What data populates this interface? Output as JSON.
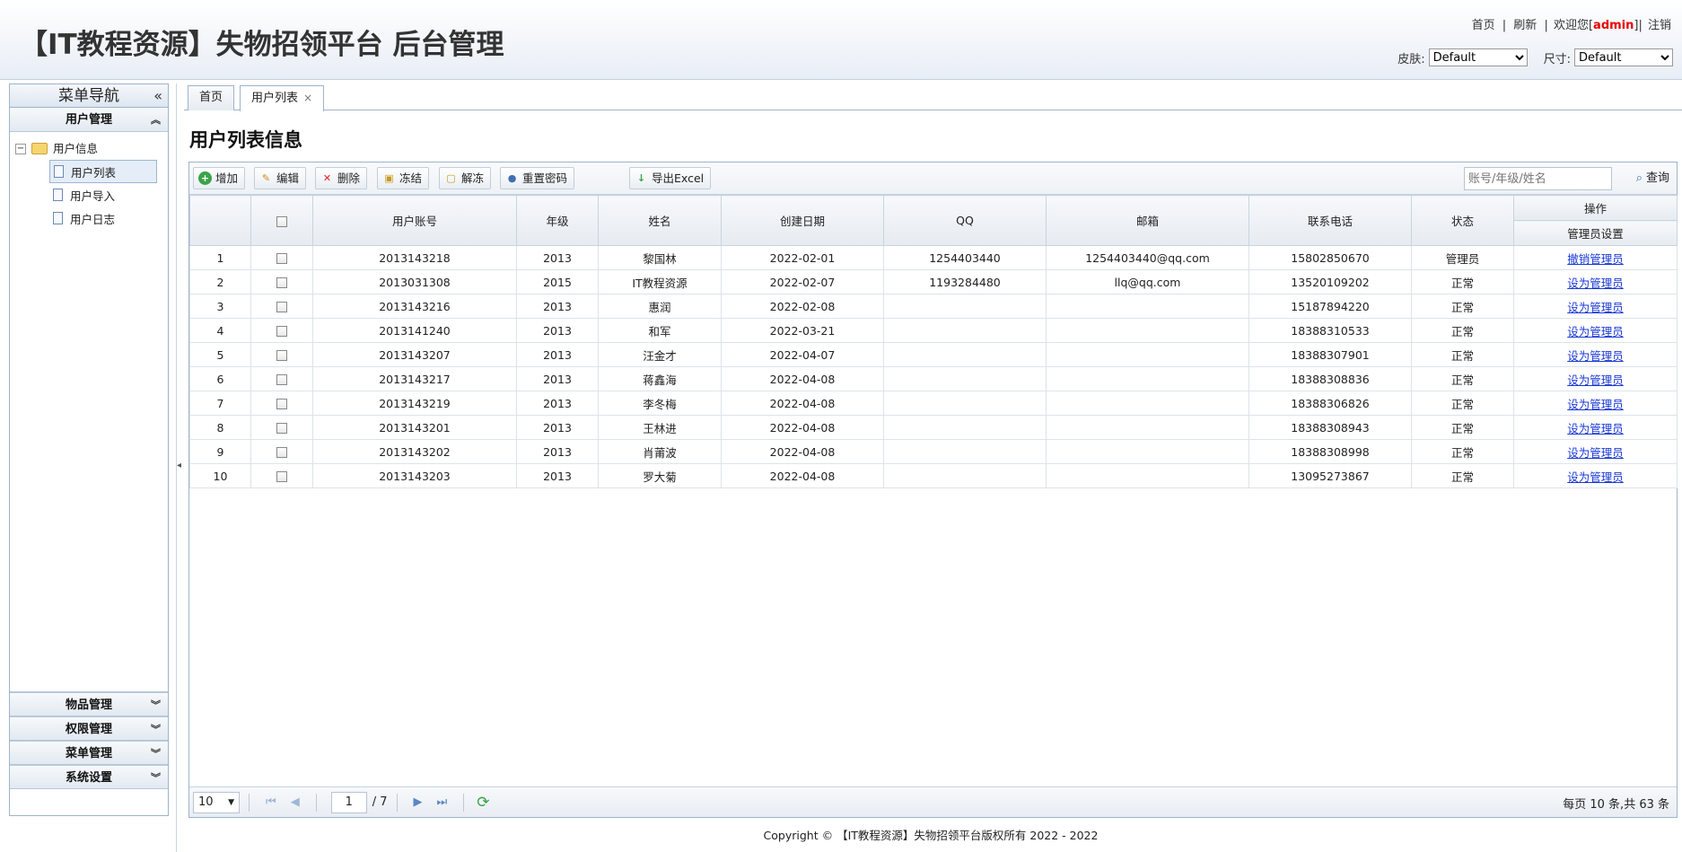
{
  "header": {
    "title": "【IT教程资源】失物招领平台 后台管理",
    "links": {
      "home": "首页",
      "sep1": "|",
      "refresh": "刷新",
      "sep2": "|",
      "welcome_prefix": "欢迎您[",
      "user": "admin",
      "welcome_suffix": "]|",
      "logout": "注销"
    },
    "skin_label": "皮肤:",
    "skin_value": "Default",
    "size_label": "尺寸:",
    "size_value": "Default"
  },
  "nav": {
    "title": "菜单导航",
    "collapse_icon": "«",
    "sections": [
      {
        "label": "用户管理",
        "arrow": "⌃"
      },
      {
        "label": "物品管理",
        "arrow": "⌄"
      },
      {
        "label": "权限管理",
        "arrow": "⌄"
      },
      {
        "label": "菜单管理",
        "arrow": "⌄"
      },
      {
        "label": "系统设置",
        "arrow": "⌄"
      }
    ],
    "tree": {
      "toggle": "−",
      "root": "用户信息",
      "children": [
        "用户列表",
        "用户导入",
        "用户日志"
      ]
    }
  },
  "tabs": [
    {
      "label": "首页"
    },
    {
      "label": "用户列表",
      "close": "×"
    }
  ],
  "page_title": "用户列表信息",
  "toolbar": {
    "add": "增加",
    "edit": "编辑",
    "delete": "删除",
    "freeze": "冻结",
    "unfreeze": "解冻",
    "reset_password": "重置密码",
    "export": "导出Excel",
    "search_placeholder": "账号/年级/姓名",
    "query": "查询"
  },
  "table": {
    "headers": {
      "account": "用户账号",
      "grade": "年级",
      "name": "姓名",
      "created": "创建日期",
      "qq": "QQ",
      "email": "邮箱",
      "phone": "联系电话",
      "status": "状态",
      "ops": "操作",
      "admin_setting": "管理员设置"
    },
    "rows": [
      {
        "no": "1",
        "account": "2013143218",
        "grade": "2013",
        "name": "黎国林",
        "created": "2022-02-01",
        "qq": "1254403440",
        "email": "1254403440@qq.com",
        "phone": "15802850670",
        "status": "管理员",
        "action": "撤销管理员"
      },
      {
        "no": "2",
        "account": "2013031308",
        "grade": "2015",
        "name": "IT教程资源",
        "created": "2022-02-07",
        "qq": "1193284480",
        "email": "llq@qq.com",
        "phone": "13520109202",
        "status": "正常",
        "action": "设为管理员"
      },
      {
        "no": "3",
        "account": "2013143216",
        "grade": "2013",
        "name": "惠润",
        "created": "2022-02-08",
        "qq": "",
        "email": "",
        "phone": "15187894220",
        "status": "正常",
        "action": "设为管理员"
      },
      {
        "no": "4",
        "account": "2013141240",
        "grade": "2013",
        "name": "和军",
        "created": "2022-03-21",
        "qq": "",
        "email": "",
        "phone": "18388310533",
        "status": "正常",
        "action": "设为管理员"
      },
      {
        "no": "5",
        "account": "2013143207",
        "grade": "2013",
        "name": "汪金才",
        "created": "2022-04-07",
        "qq": "",
        "email": "",
        "phone": "18388307901",
        "status": "正常",
        "action": "设为管理员"
      },
      {
        "no": "6",
        "account": "2013143217",
        "grade": "2013",
        "name": "蒋鑫海",
        "created": "2022-04-08",
        "qq": "",
        "email": "",
        "phone": "18388308836",
        "status": "正常",
        "action": "设为管理员"
      },
      {
        "no": "7",
        "account": "2013143219",
        "grade": "2013",
        "name": "李冬梅",
        "created": "2022-04-08",
        "qq": "",
        "email": "",
        "phone": "18388306826",
        "status": "正常",
        "action": "设为管理员"
      },
      {
        "no": "8",
        "account": "2013143201",
        "grade": "2013",
        "name": "王林进",
        "created": "2022-04-08",
        "qq": "",
        "email": "",
        "phone": "18388308943",
        "status": "正常",
        "action": "设为管理员"
      },
      {
        "no": "9",
        "account": "2013143202",
        "grade": "2013",
        "name": "肖莆波",
        "created": "2022-04-08",
        "qq": "",
        "email": "",
        "phone": "18388308998",
        "status": "正常",
        "action": "设为管理员"
      },
      {
        "no": "10",
        "account": "2013143203",
        "grade": "2013",
        "name": "罗大菊",
        "created": "2022-04-08",
        "qq": "",
        "email": "",
        "phone": "13095273867",
        "status": "正常",
        "action": "设为管理员"
      }
    ]
  },
  "pager": {
    "page_size": "10",
    "current_page": "1",
    "total_pages": "/ 7",
    "info": "每页 10 条,共 63 条"
  },
  "footer": "Copyright © 【IT教程资源】失物招领平台版权所有 2022 - 2022",
  "colors": {
    "admin": "#e60000",
    "link": "#1a39d6",
    "border": "#9eb3cc"
  }
}
